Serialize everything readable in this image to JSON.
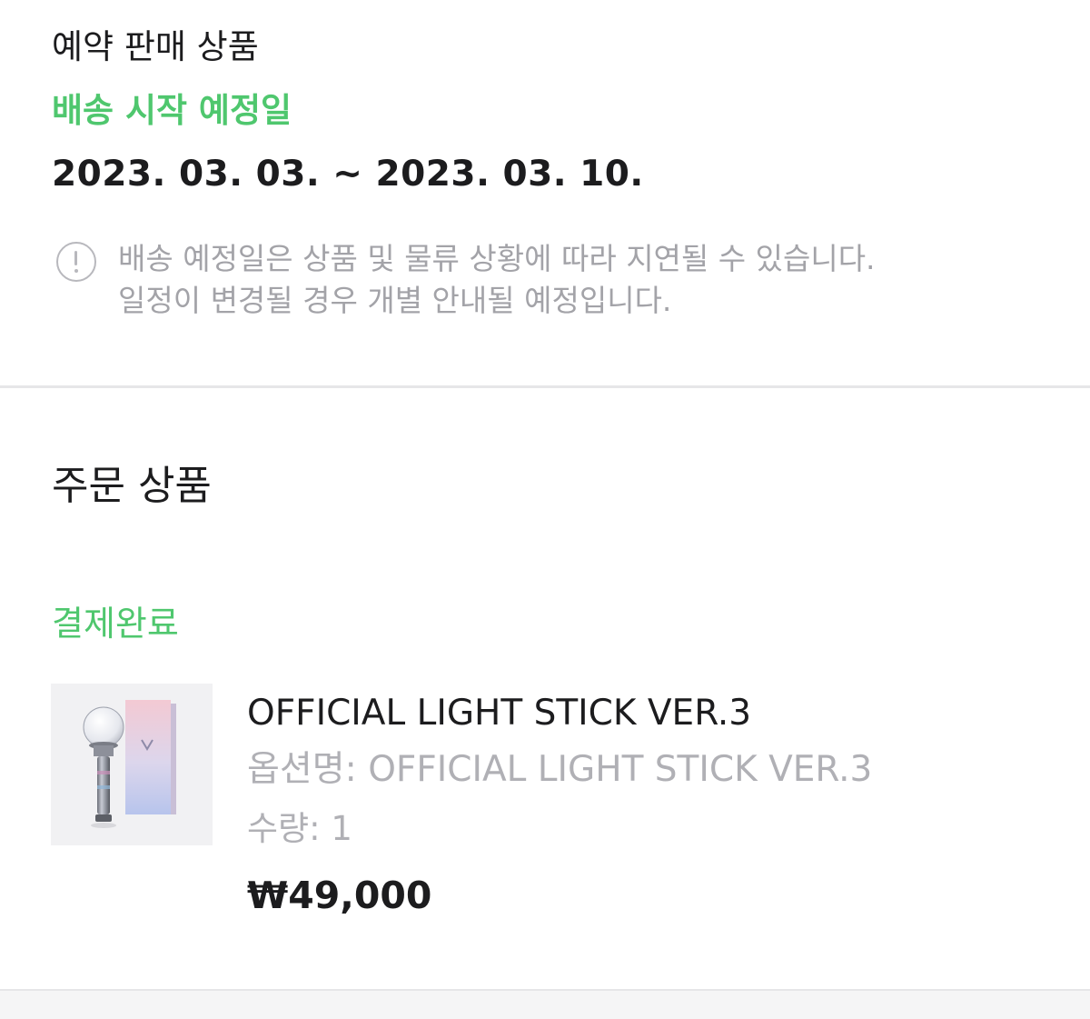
{
  "preorder": {
    "label": "예약 판매 상품",
    "ship_title": "배송 시작 예정일",
    "ship_range": "2023. 03. 03. ~ 2023. 03. 10.",
    "notice_line1": "배송 예정일은 상품 및 물류 상황에 따라 지연될 수 있습니다.",
    "notice_line2": "일정이 변경될 경우 개별 안내될 예정입니다.",
    "notice_icon": "info-circle-icon"
  },
  "order": {
    "title": "주문 상품",
    "status": "결제완료",
    "item": {
      "name": "OFFICIAL LIGHT STICK VER.3",
      "option_label": "옵션명:",
      "option_value": "OFFICIAL LIGHT STICK VER.3",
      "quantity_label": "수량:",
      "quantity_value": "1",
      "price": "₩49,000"
    }
  },
  "colors": {
    "accent_green": "#4fc76e",
    "text_primary": "#1c1c1e",
    "text_muted": "#a3a3a8",
    "divider": "#e6e6e8"
  }
}
